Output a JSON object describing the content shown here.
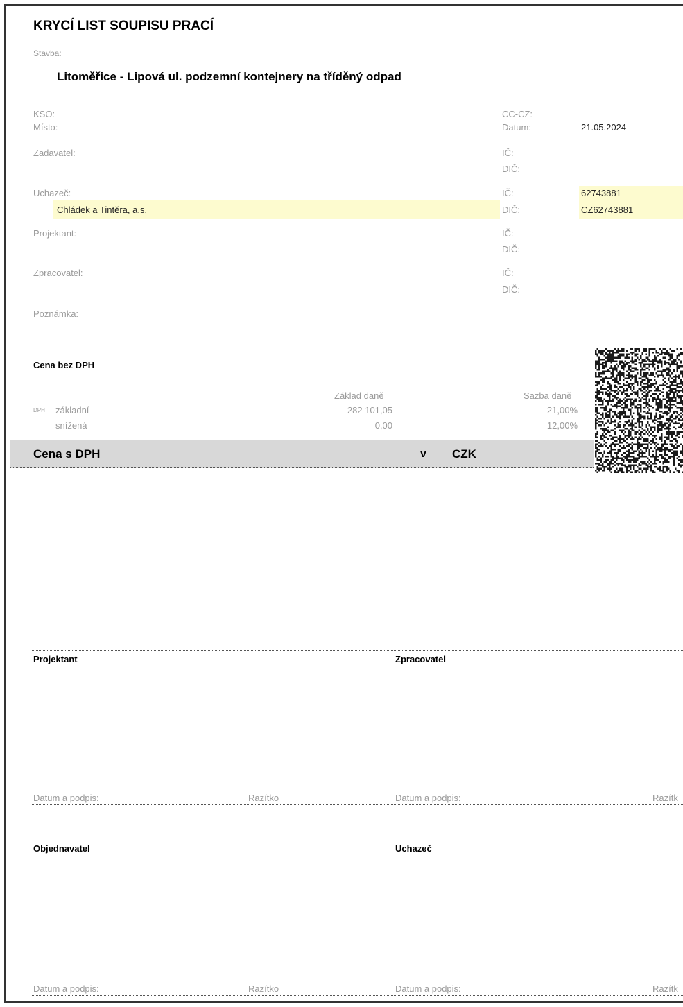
{
  "title": "KRYCÍ LIST SOUPISU PRACÍ",
  "stavba": {
    "label": "Stavba:",
    "value": "Litoměřice - Lipová ul. podzemní kontejnery na tříděný odpad"
  },
  "kso": {
    "label": "KSO:"
  },
  "misto": {
    "label": "Místo:"
  },
  "cc_cz": {
    "label": "CC-CZ:"
  },
  "datum": {
    "label": "Datum:",
    "value": "21.05.2024"
  },
  "zadavatel": {
    "label": "Zadavatel:",
    "ic_label": "IČ:",
    "dic_label": "DIČ:"
  },
  "uchazec": {
    "label": "Uchazeč:",
    "name": "Chládek a Tintěra, a.s.",
    "ic_label": "IČ:",
    "ic": "62743881",
    "dic_label": "DIČ:",
    "dic": "CZ62743881"
  },
  "projektant": {
    "label": "Projektant:",
    "ic_label": "IČ:",
    "dic_label": "DIČ:"
  },
  "zpracovatel": {
    "label": "Zpracovatel:",
    "ic_label": "IČ:",
    "dic_label": "DIČ:"
  },
  "poznamka": {
    "label": "Poznámka:"
  },
  "cena_bez_dph": "Cena bez DPH",
  "tax": {
    "col_base": "Základ daně",
    "col_rate": "Sazba daně",
    "dph_label": "DPH",
    "rows": [
      {
        "name": "základní",
        "base": "282 101,05",
        "rate": "21,00%"
      },
      {
        "name": "snížená",
        "base": "0,00",
        "rate": "12,00%"
      }
    ]
  },
  "cena_s_dph": {
    "label": "Cena s DPH",
    "v": "v",
    "currency": "CZK"
  },
  "signatures": {
    "projektant": "Projektant",
    "zpracovatel": "Zpracovatel",
    "objednavatel": "Objednavatel",
    "uchazec": "Uchazeč",
    "datum_podpis": "Datum a podpis:",
    "razitko": "Razítko",
    "razitko_cut": "Razítk"
  }
}
